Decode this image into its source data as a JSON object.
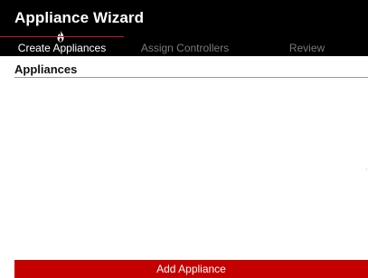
{
  "app": {
    "title": "Appliance Wizard"
  },
  "steps": [
    {
      "label": "Create Appliances",
      "state": "active",
      "icon": "flame-icon"
    },
    {
      "label": "Assign Controllers",
      "state": "inactive"
    },
    {
      "label": "Review",
      "state": "inactive"
    }
  ],
  "section": {
    "title": "Appliances",
    "items": []
  },
  "actions": {
    "add_label": "Add Appliance"
  },
  "colors": {
    "header_bg": "#000000",
    "accent": "#c40000",
    "active_step_text": "#ffffff",
    "inactive_step_text": "#7a7a7a"
  }
}
